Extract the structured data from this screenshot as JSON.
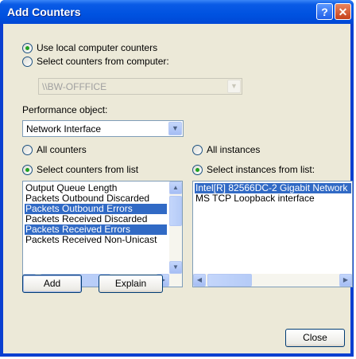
{
  "window": {
    "title": "Add Counters"
  },
  "source": {
    "use_local_label": "Use local computer counters",
    "select_from_computer_label": "Select counters from computer:",
    "computer_value": "\\\\BW-OFFFICE"
  },
  "perf_object": {
    "label": "Performance object:",
    "value": "Network Interface"
  },
  "counters": {
    "all_label": "All counters",
    "select_label": "Select counters from list",
    "items": [
      {
        "label": "Output Queue Length",
        "selected": false
      },
      {
        "label": "Packets Outbound Discarded",
        "selected": false
      },
      {
        "label": "Packets Outbound Errors",
        "selected": true
      },
      {
        "label": "Packets Received Discarded",
        "selected": false
      },
      {
        "label": "Packets Received Errors",
        "selected": true
      },
      {
        "label": "Packets Received Non-Unicast",
        "selected": false
      }
    ]
  },
  "instances": {
    "all_label": "All instances",
    "select_label": "Select instances from list:",
    "items": [
      {
        "label": "Intel[R] 82566DC-2 Gigabit Network",
        "selected": true
      },
      {
        "label": "MS TCP Loopback interface",
        "selected": false
      }
    ]
  },
  "buttons": {
    "add": "Add",
    "explain": "Explain",
    "close": "Close"
  },
  "icons": {
    "help": "help-icon",
    "close": "close-icon"
  }
}
